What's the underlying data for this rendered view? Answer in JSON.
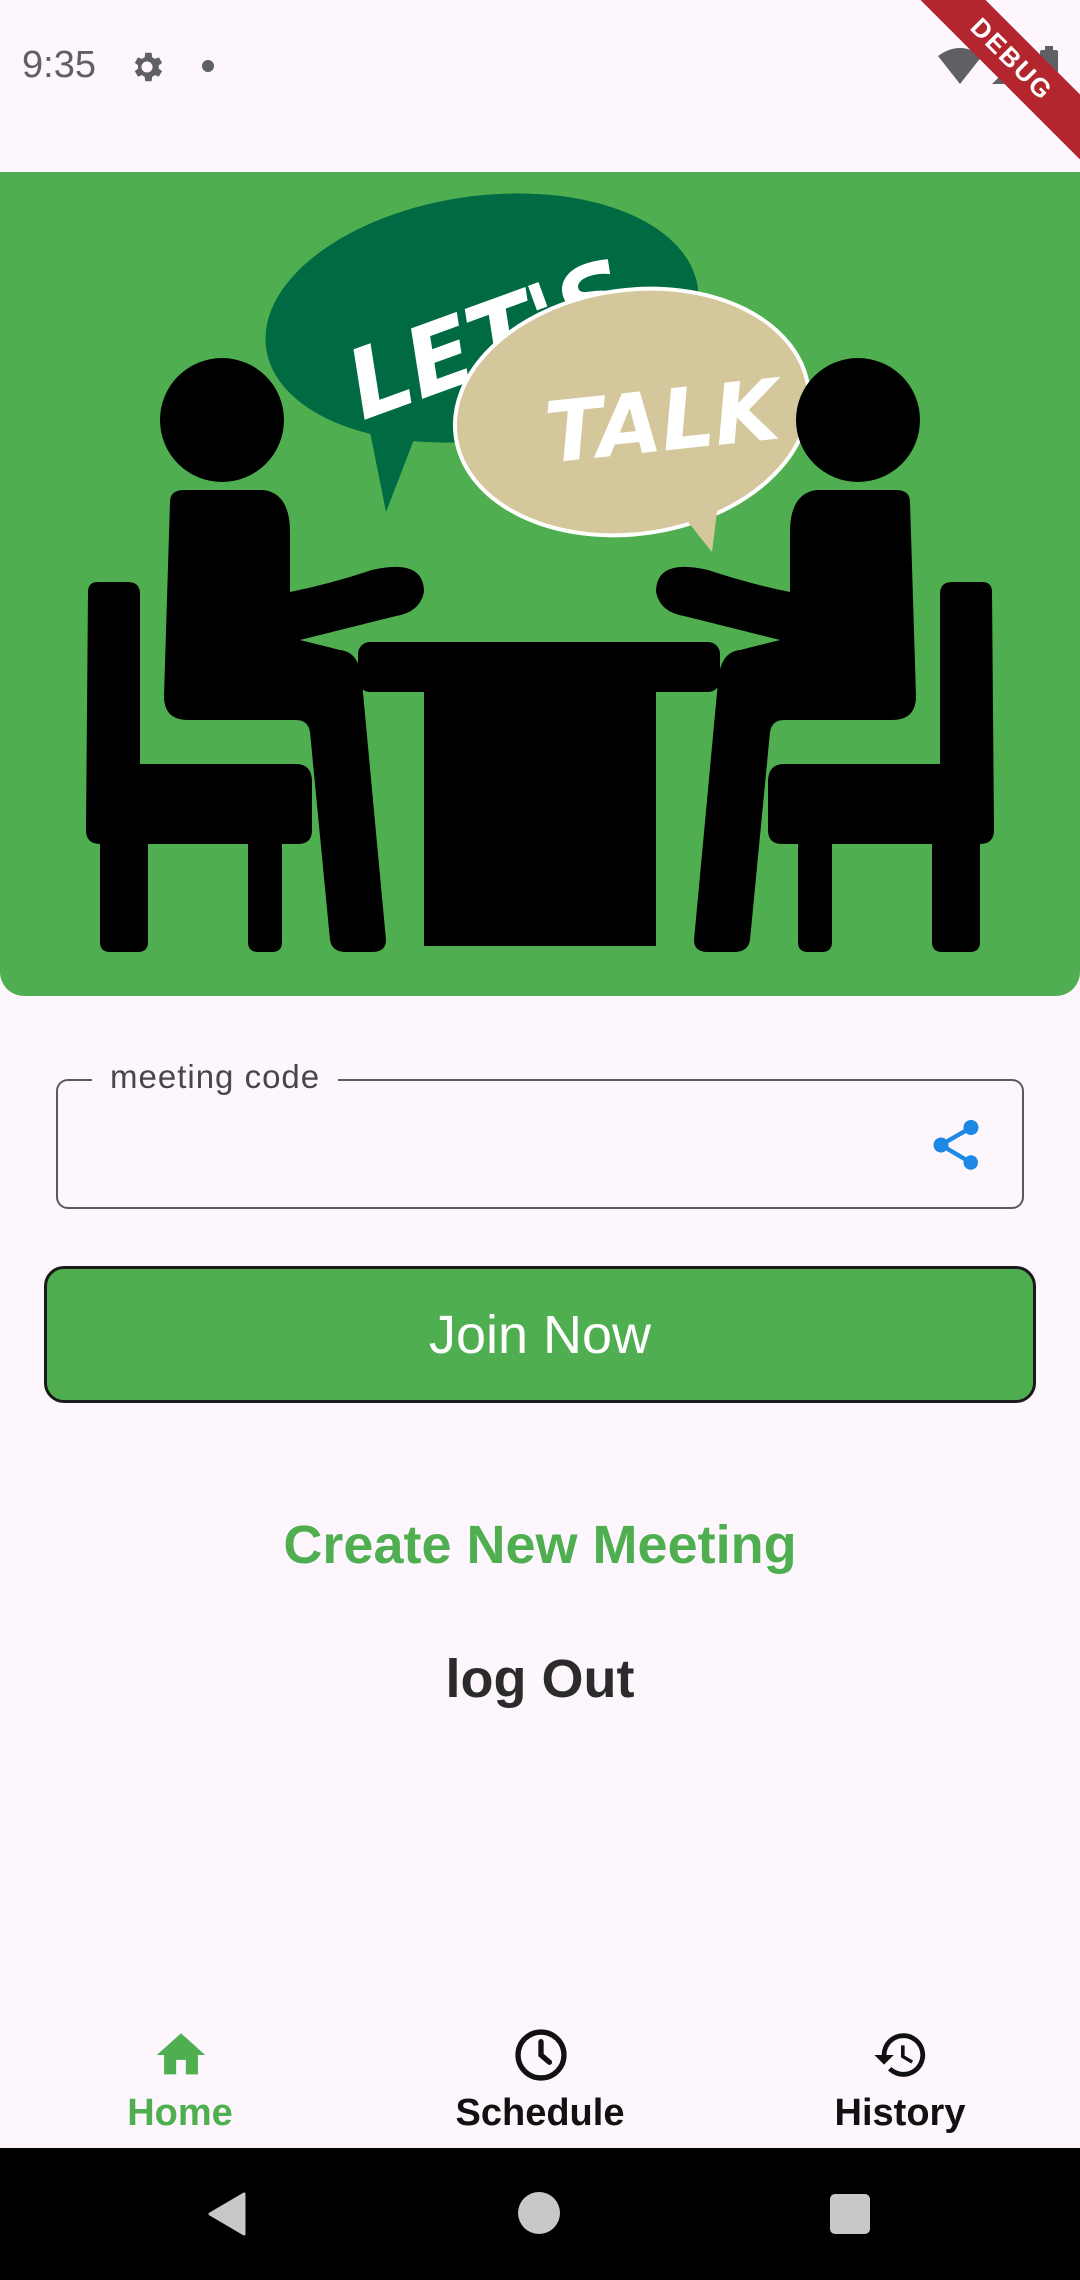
{
  "status_bar": {
    "time": "9:35",
    "left_icons": [
      "gear-icon",
      "dot-icon"
    ],
    "right_icons": [
      "wifi-icon",
      "signal-icon",
      "battery-icon"
    ],
    "debug_banner": "DEBUG"
  },
  "hero": {
    "image": "lets-talk-illustration",
    "bubble_left_text": "LET'S",
    "bubble_right_text": "TALK",
    "background_color": "#4faf50"
  },
  "meeting_code": {
    "label": "meeting code",
    "value": "",
    "placeholder": "",
    "trailing_icon": "share-icon"
  },
  "join_button": {
    "label": "Join Now"
  },
  "create_meeting": {
    "label": "Create New Meeting"
  },
  "logout": {
    "label": "log Out"
  },
  "bottom_nav": {
    "items": [
      {
        "label": "Home",
        "icon": "home-icon",
        "active": true
      },
      {
        "label": "Schedule",
        "icon": "clock-icon",
        "active": false
      },
      {
        "label": "History",
        "icon": "history-icon",
        "active": false
      }
    ]
  },
  "system_nav": {
    "buttons": [
      "back-icon",
      "home-circle-icon",
      "recents-icon"
    ]
  },
  "colors": {
    "accent": "#4faf50",
    "dark_green": "#006a43",
    "bubble_tan": "#d4c79b",
    "share_blue": "#1e88e5",
    "background": "#fdf7fd"
  }
}
